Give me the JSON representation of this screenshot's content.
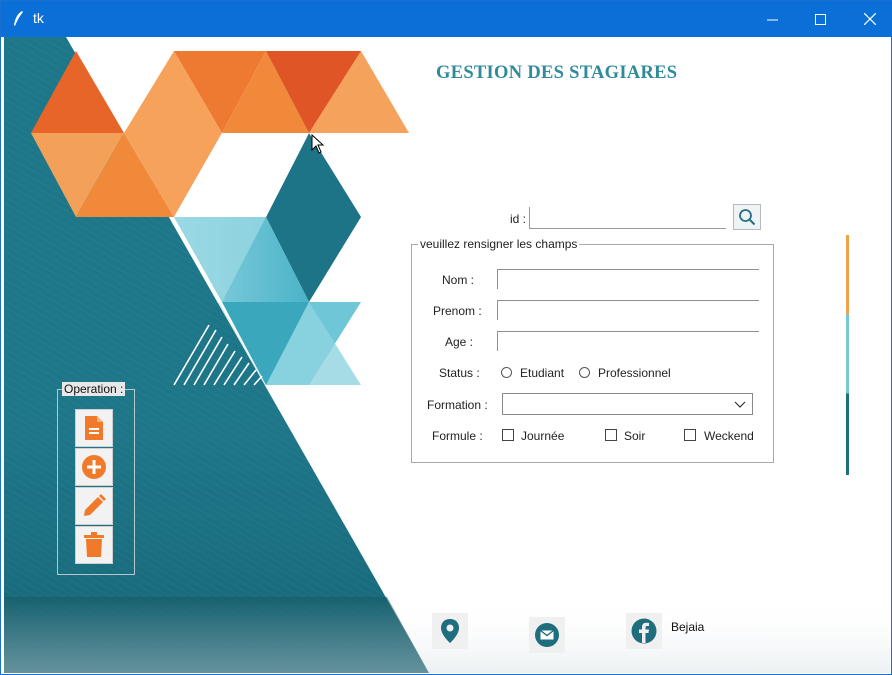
{
  "window": {
    "title": "tk"
  },
  "header": {
    "title": "GESTION DES STAGIARES"
  },
  "search": {
    "id_label": "id :",
    "id_value": ""
  },
  "form": {
    "legend": "veuillez rensigner les champs",
    "nom_label": "Nom :",
    "prenom_label": "Prenom :",
    "age_label": "Age :",
    "status_label": "Status :",
    "status_options": [
      "Etudiant",
      "Professionnel"
    ],
    "formation_label": "Formation :",
    "formation_value": "",
    "formule_label": "Formule :",
    "formule_options": [
      "Journée",
      "Soir",
      "Weckend"
    ]
  },
  "operations": {
    "legend": "Operation :",
    "buttons": [
      "document-icon",
      "add-icon",
      "edit-icon",
      "delete-icon"
    ]
  },
  "footer": {
    "icons": [
      "location-icon",
      "email-icon",
      "facebook-icon"
    ],
    "city": "Bejaia"
  },
  "colors": {
    "teal_dark": "#1d7486",
    "teal_light": "#6ec6d6",
    "orange": "#f08a3a",
    "orange_dark": "#d94e1f",
    "title_blue": "#2f8a9b",
    "titlebar": "#0a6fd6"
  }
}
